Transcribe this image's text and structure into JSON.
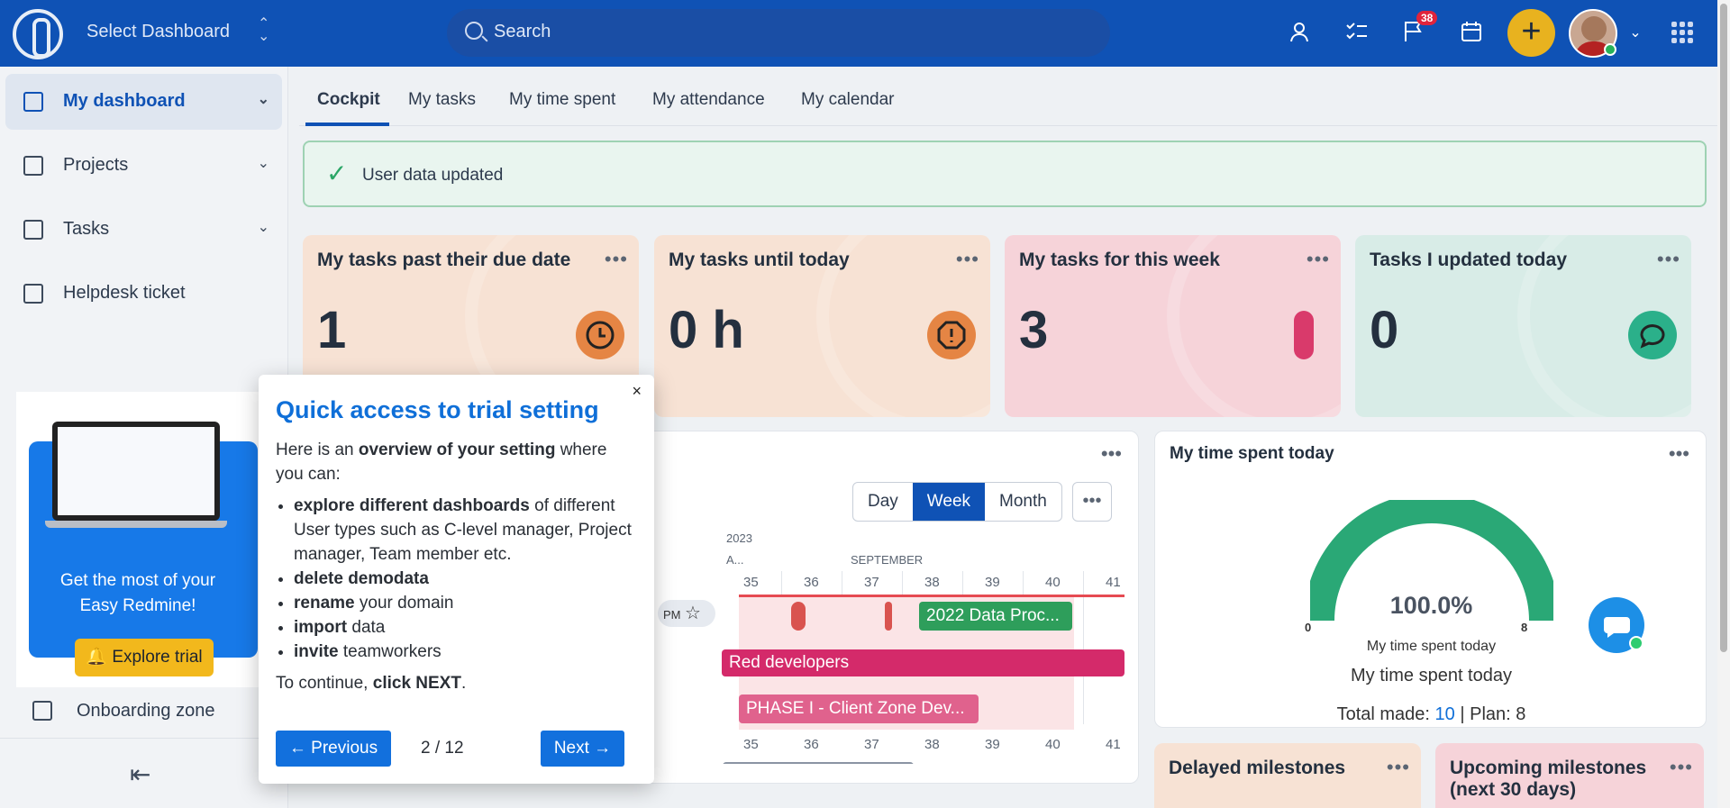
{
  "header": {
    "select_dashboard": "Select Dashboard",
    "search_placeholder": "Search",
    "notifications_count": "38"
  },
  "sidebar": {
    "items": [
      {
        "label": "My dashboard"
      },
      {
        "label": "Projects"
      },
      {
        "label": "Tasks"
      },
      {
        "label": "Helpdesk ticket"
      }
    ],
    "onboarding": "Onboarding zone"
  },
  "promo": {
    "line1": "Get the most of your",
    "line2": "Easy Redmine!",
    "button": "Explore trial"
  },
  "tabs": [
    "Cockpit",
    "My tasks",
    "My time spent",
    "My attendance",
    "My calendar"
  ],
  "flash": {
    "message": "User data updated"
  },
  "cards": [
    {
      "title": "My tasks past their due date",
      "value": "1"
    },
    {
      "title": "My tasks until today",
      "value": "0 h"
    },
    {
      "title": "My tasks for this week",
      "value": "3"
    },
    {
      "title": "Tasks I updated today",
      "value": "0"
    }
  ],
  "planner": {
    "views": [
      "Day",
      "Week",
      "Month"
    ],
    "active_view": "Week",
    "year": "2023",
    "month_a": "A...",
    "month": "SEPTEMBER",
    "weeks": [
      "35",
      "36",
      "37",
      "38",
      "39",
      "40",
      "41"
    ],
    "pm_label": "PM",
    "bars": {
      "data_proc": "2022 Data Proc...",
      "red_dev": "Red developers",
      "phase": "PHASE I - Client Zone Dev..."
    }
  },
  "time_spent": {
    "title": "My time spent today",
    "percent": "100.0%",
    "gauge_min": "0",
    "gauge_max": "8",
    "gauge_caption": "My time spent today",
    "subtitle": "My time spent today",
    "total_label": "Total made:",
    "total_value": "10",
    "plan_label": "| Plan: 8"
  },
  "bottom_cards": {
    "delayed": "Delayed milestones",
    "upcoming1": "Upcoming milestones",
    "upcoming2": "(next 30 days)"
  },
  "modal": {
    "title": "Quick access to trial setting",
    "intro_a": "Here is an ",
    "intro_b": "overview of your setting",
    "intro_c": " where you can:",
    "li1_b": "explore different dashboards",
    "li1_t": " of different User types such as C-level manager, Project manager, Team member etc.",
    "li2_b": "delete demodata",
    "li3_b": "rename",
    "li3_t": " your domain",
    "li4_b": "import",
    "li4_t": " data",
    "li5_b": "invite",
    "li5_t": " teamworkers",
    "cont_a": "To continue, ",
    "cont_b": "click NEXT",
    "cont_c": ".",
    "prev": "← Previous",
    "page": "2 / 12",
    "next": "Next →"
  }
}
